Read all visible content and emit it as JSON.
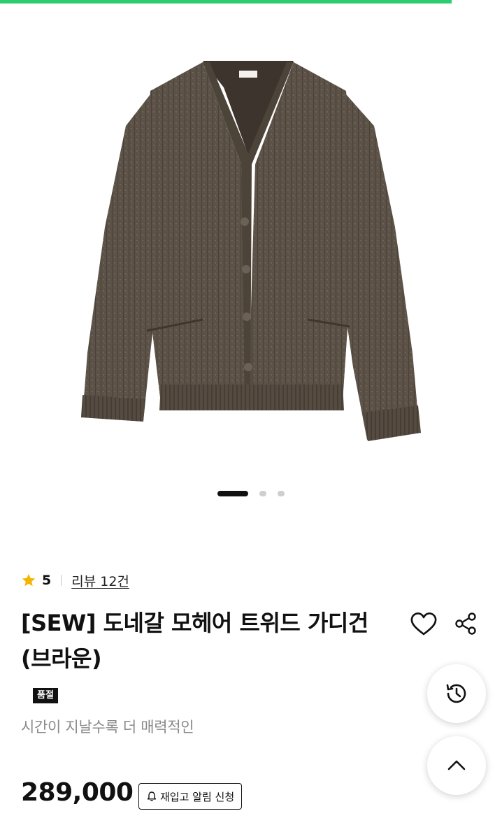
{
  "progress": {
    "fraction": 0.9,
    "color": "#2ecc71"
  },
  "gallery": {
    "image_alt": "brown mohair tweed cardigan",
    "slide_count": 3,
    "active_index": 0
  },
  "rating": {
    "star_icon": "star-icon",
    "star_color": "#f5b400",
    "value": "5",
    "review_link": "리뷰 12건"
  },
  "product": {
    "title": "[SEW] 도네갈 모헤어 트위드 가디건 (브라운)",
    "sold_out_badge": "품절",
    "subtitle": "시간이 지날수록 더 매력적인",
    "price": "289,000"
  },
  "actions": {
    "wishlist_icon": "heart-icon",
    "share_icon": "share-icon",
    "restock_label": "재입고 알림 신청",
    "restock_icon": "bell-icon",
    "history_icon": "history-icon",
    "scroll_top_icon": "chevron-up-icon"
  }
}
